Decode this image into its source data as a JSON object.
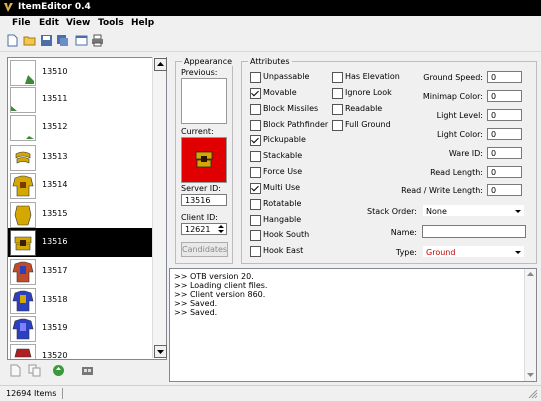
{
  "window": {
    "title": "ItemEditor 0.4"
  },
  "menu": [
    "File",
    "Edit",
    "View",
    "Tools",
    "Help"
  ],
  "toolbar": {
    "icons": [
      "new-file-icon",
      "open-folder-icon",
      "save-icon",
      "save-as-icon",
      "preferences-icon",
      "print-icon"
    ]
  },
  "items": [
    {
      "id": "13510",
      "color": "#3a8a3a"
    },
    {
      "id": "13511",
      "color": "#3a8a3a"
    },
    {
      "id": "13512",
      "color": "#3a8a3a"
    },
    {
      "id": "13513",
      "color": "#d4a800"
    },
    {
      "id": "13514",
      "color": "#d4a800"
    },
    {
      "id": "13515",
      "color": "#d4a800"
    },
    {
      "id": "13516",
      "color": "#d4a800"
    },
    {
      "id": "13517",
      "color": "#c04a2a"
    },
    {
      "id": "13518",
      "color": "#2a40c0"
    },
    {
      "id": "13519",
      "color": "#2a40c0"
    },
    {
      "id": "13520",
      "color": "#b02020"
    }
  ],
  "selected_item": "13516",
  "appearance": {
    "title": "Appearance",
    "previous_label": "Previous:",
    "current_label": "Current:",
    "server_id_label": "Server ID:",
    "server_id": "13516",
    "client_id_label": "Client ID:",
    "client_id": "12621",
    "candidates_label": "Candidates",
    "current_bg": "#e00000"
  },
  "attributes": {
    "title": "Attributes",
    "col1": [
      {
        "label": "Unpassable",
        "checked": false
      },
      {
        "label": "Movable",
        "checked": true
      },
      {
        "label": "Block Missiles",
        "checked": false
      },
      {
        "label": "Block Pathfinder",
        "checked": false
      },
      {
        "label": "Pickupable",
        "checked": true
      },
      {
        "label": "Stackable",
        "checked": false
      },
      {
        "label": "Force Use",
        "checked": false
      },
      {
        "label": "Multi Use",
        "checked": true
      },
      {
        "label": "Rotatable",
        "checked": false
      },
      {
        "label": "Hangable",
        "checked": false
      },
      {
        "label": "Hook South",
        "checked": false
      },
      {
        "label": "Hook East",
        "checked": false
      }
    ],
    "col2": [
      {
        "label": "Has Elevation",
        "checked": false
      },
      {
        "label": "Ignore Look",
        "checked": false
      },
      {
        "label": "Readable",
        "checked": false
      },
      {
        "label": "Full Ground",
        "checked": false
      }
    ],
    "fields": [
      {
        "label": "Ground Speed:",
        "value": "0"
      },
      {
        "label": "Minimap Color:",
        "value": "0"
      },
      {
        "label": "Light Level:",
        "value": "0"
      },
      {
        "label": "Light Color:",
        "value": "0"
      },
      {
        "label": "Ware ID:",
        "value": "0"
      },
      {
        "label": "Read Length:",
        "value": "0"
      },
      {
        "label": "Read / Write Length:",
        "value": "0"
      }
    ],
    "stack_order_label": "Stack Order:",
    "stack_order": "None",
    "name_label": "Name:",
    "name": "",
    "type_label": "Type:",
    "type": "Ground",
    "type_color": "#c00000"
  },
  "log": [
    ">> OTB version 20.",
    ">> Loading client files.",
    ">> Client version 860.",
    ">> Saved.",
    ">> Saved."
  ],
  "status": {
    "items_count": "12694 Items"
  }
}
